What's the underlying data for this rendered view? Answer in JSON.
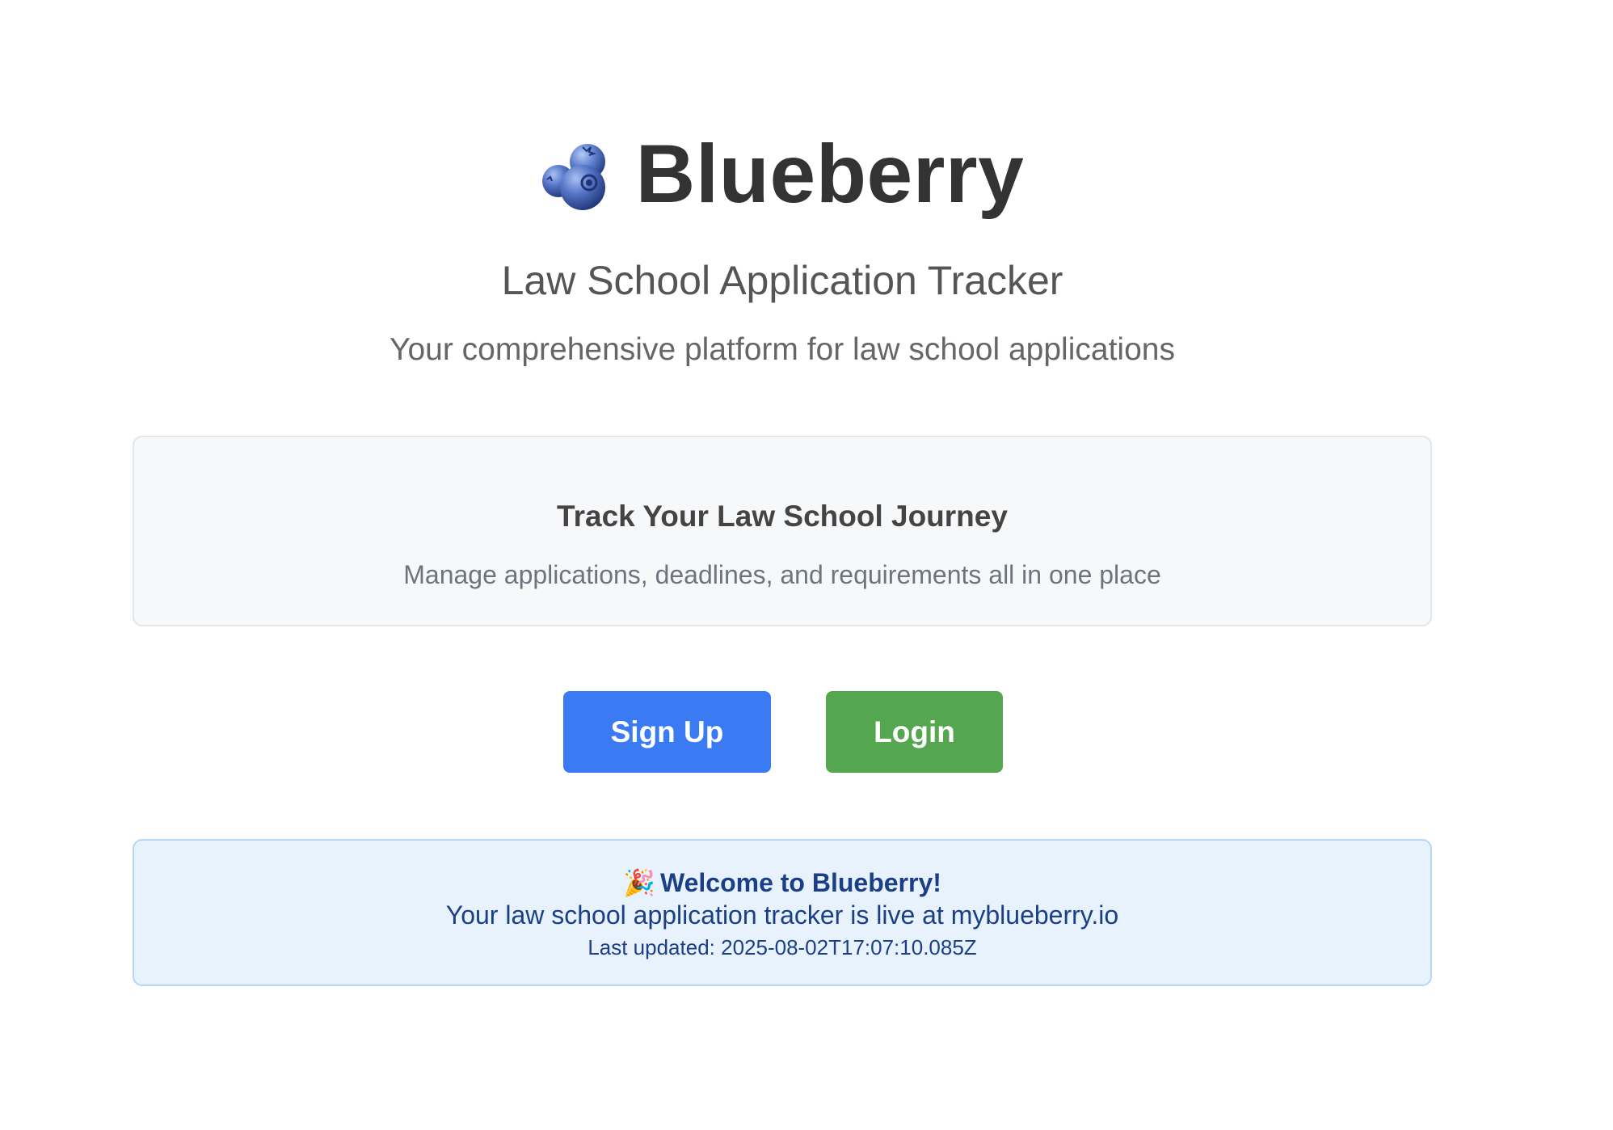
{
  "brand": {
    "icon": "blueberry-icon",
    "title": "Blueberry"
  },
  "hero": {
    "subtitle": "Law School Application Tracker",
    "tagline": "Your comprehensive platform for law school applications"
  },
  "feature": {
    "heading": "Track Your Law School Journey",
    "text": "Manage applications, deadlines, and requirements all in one place"
  },
  "actions": {
    "signup_label": "Sign Up",
    "login_label": "Login"
  },
  "welcome": {
    "icon": "party-popper-icon",
    "emoji": "🎉",
    "title": "Welcome to Blueberry!",
    "message": "Your law school application tracker is live at myblueberry.io",
    "updated": "Last updated: 2025-08-02T17:07:10.085Z"
  },
  "colors": {
    "primary_blue": "#3a7bf4",
    "success_green": "#54a64f",
    "title_text": "#333333",
    "welcome_bg": "#e8f2fc",
    "welcome_text": "#1a3f87"
  }
}
